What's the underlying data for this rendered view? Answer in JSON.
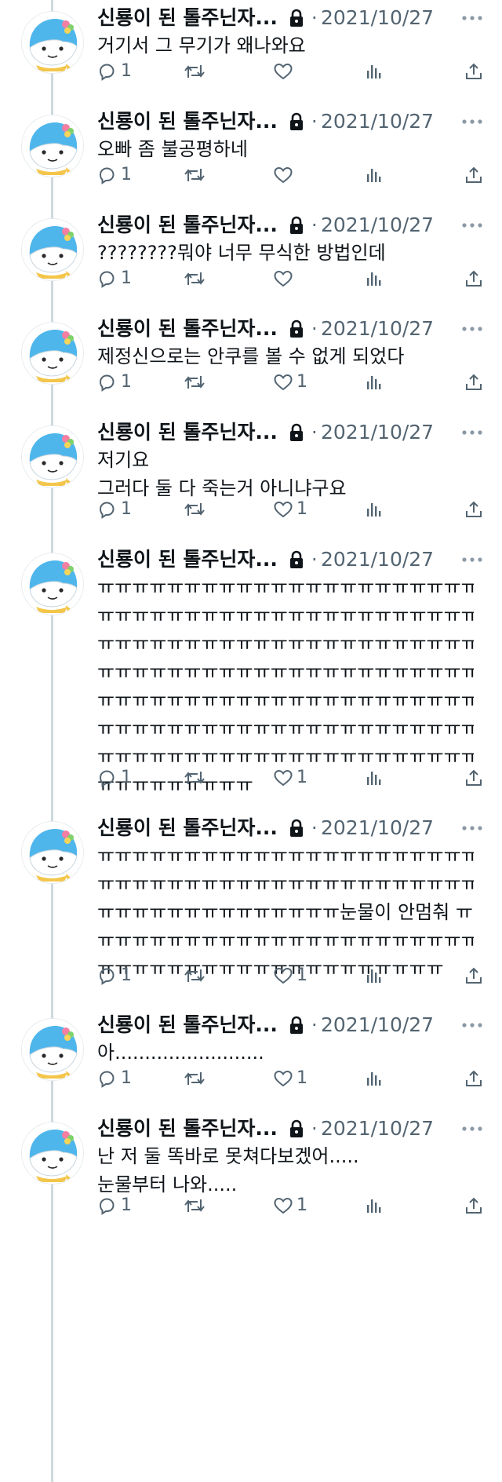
{
  "colors": {
    "text": "#0f1419",
    "muted": "#536471",
    "thread_line": "#cfd9de",
    "avatar_blue": "#4fb6ec",
    "avatar_scarf": "#f3c64b"
  },
  "icons": [
    "lock-icon",
    "more-icon",
    "reply-icon",
    "retweet-icon",
    "like-icon",
    "views-icon",
    "share-icon"
  ],
  "tweets": [
    {
      "author": "신룡이 된 톨주닌자...",
      "sep": "·",
      "date": "2021/10/27",
      "text": "거기서 그 무기가 왜나와요",
      "replies": "1",
      "likes": ""
    },
    {
      "author": "신룡이 된 톨주닌자...",
      "sep": "·",
      "date": "2021/10/27",
      "text": "오빠 좀 불공평하네",
      "replies": "1",
      "likes": ""
    },
    {
      "author": "신룡이 된 톨주닌자...",
      "sep": "·",
      "date": "2021/10/27",
      "text": "????????뭐야 너무 무식한 방법인데",
      "replies": "1",
      "likes": ""
    },
    {
      "author": "신룡이 된 톨주닌자...",
      "sep": "·",
      "date": "2021/10/27",
      "text": "제정신으로는 안쿠를 볼 수 없게 되었다",
      "replies": "1",
      "likes": "1"
    },
    {
      "author": "신룡이 된 톨주닌자...",
      "sep": "·",
      "date": "2021/10/27",
      "text": "저기요\n그러다 둘 다 죽는거 아니냐구요",
      "replies": "1",
      "likes": "1"
    },
    {
      "author": "신룡이 된 톨주닌자...",
      "sep": "·",
      "date": "2021/10/27",
      "text": "ㅠㅠㅠㅠㅠㅠㅠㅠㅠㅠㅠㅠㅠㅠㅠㅠㅠㅠㅠㅠㅠㅠㅠㅠㅠ\nㅠㅠㅠㅠㅠㅠㅠㅠㅠㅠㅠㅠㅠㅠㅠㅠㅠㅠㅠㅠㅠㅠㅠㅠㅠ\nㅠㅠㅠㅠㅠㅠㅠㅠㅠㅠㅠㅠㅠㅠㅠㅠㅠㅠㅠㅠㅠㅠㅠㅠㅠ\nㅠㅠㅠㅠㅠㅠㅠㅠㅠㅠㅠㅠㅠㅠㅠㅠㅠㅠㅠㅠㅠㅠㅠㅠㅠ\nㅠㅠㅠㅠㅠㅠㅠㅠㅠㅠㅠㅠㅠㅠㅠㅠㅠㅠㅠㅠㅠㅠㅠㅠㅠ\nㅠㅠㅠㅠㅠㅠㅠㅠㅠㅠㅠㅠㅠㅠㅠㅠㅠㅠㅠㅠㅠㅠㅠㅠㅠ\nㅠㅠㅠㅠㅠㅠㅠㅠㅠㅠㅠㅠㅠㅠㅠㅠㅠㅠㅠㅠㅠㅠㅠㅠㅠ\nㅠㅠㅠㅠㅠㅠㅠㅠㅠ",
      "replies": "1",
      "likes": "1"
    },
    {
      "author": "신룡이 된 톨주닌자...",
      "sep": "·",
      "date": "2021/10/27",
      "text": "ㅠㅠㅠㅠㅠㅠㅠㅠㅠㅠㅠㅠㅠㅠㅠㅠㅠㅠㅠㅠㅠㅠㅠㅠㅠ\nㅠㅠㅠㅠㅠㅠㅠㅠㅠㅠㅠㅠㅠㅠㅠㅠㅠㅠㅠㅠㅠㅠㅠㅠㅠ\nㅠㅠㅠㅠㅠㅠㅠㅠㅠㅠㅠㅠㅠㅠ눈물이 안멈춰 ㅠㅠ\nㅠㅠㅠㅠㅠㅠㅠㅠㅠㅠㅠㅠㅠㅠㅠㅠㅠㅠㅠㅠㅠㅠㅠㅠㅠ\nㅠㅠㅠㅠㅠㅠㅠㅠㅠㅠㅠㅠㅠㅠㅠㅠㅠㅠㅠㅠ",
      "replies": "1",
      "likes": "1"
    },
    {
      "author": "신룡이 된 톨주닌자...",
      "sep": "·",
      "date": "2021/10/27",
      "text": "아.........................",
      "replies": "1",
      "likes": "1"
    },
    {
      "author": "신룡이 된 톨주닌자...",
      "sep": "·",
      "date": "2021/10/27",
      "text": "난 저 둘 똑바로 못쳐다보겠어.....\n눈물부터 나와.....",
      "replies": "1",
      "likes": "1"
    }
  ]
}
